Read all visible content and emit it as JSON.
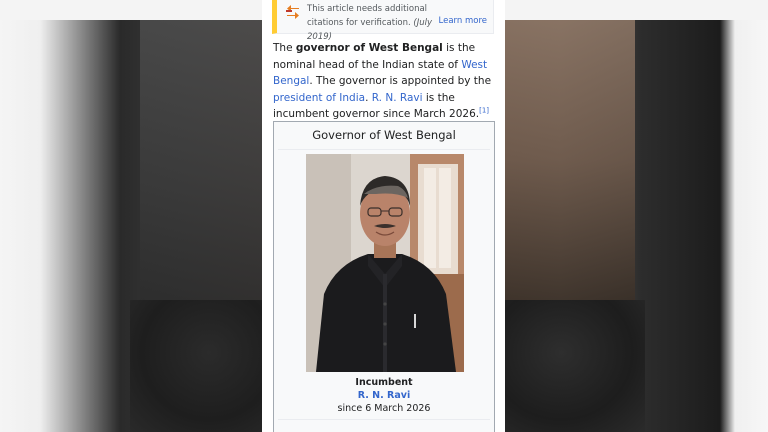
{
  "notice": {
    "icon": "citation-needed-icon",
    "text": "This article needs additional citations for verification.",
    "date": "(July 2019)",
    "learn_more": "Learn more"
  },
  "intro": {
    "part1": "The ",
    "bold": "governor of West Bengal",
    "part2": " is the nominal head of the Indian state of ",
    "link_state": "West Bengal",
    "part3": ". The governor is appointed by the ",
    "link_president": "president of India",
    "part4": ". ",
    "link_ravi": "R. N. Ravi",
    "part5": " is the incumbent governor since March 2026.",
    "ref": "[1]"
  },
  "infobox": {
    "title": "Governor of West Bengal",
    "caption_label": "Incumbent",
    "caption_name": "R. N. Ravi",
    "caption_since": "since 6 March 2026"
  },
  "colors": {
    "link": "#3366cc",
    "notice_bar": "#ffcc33",
    "text": "#202122"
  }
}
